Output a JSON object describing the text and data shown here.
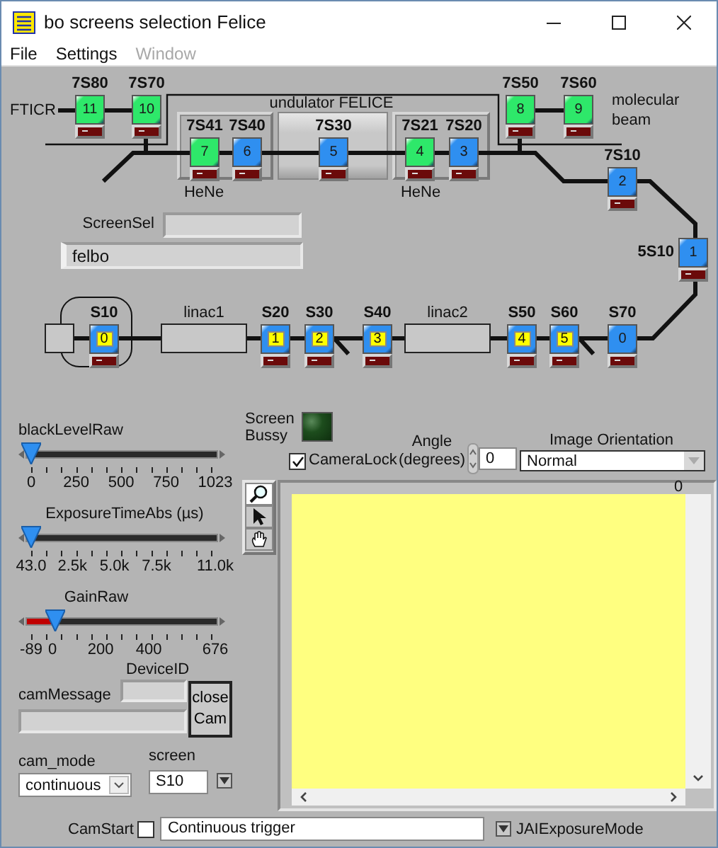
{
  "window": {
    "title": "bo screens selection Felice"
  },
  "menu": [
    {
      "label": "File",
      "disabled": false
    },
    {
      "label": "Settings",
      "disabled": false
    },
    {
      "label": "Window",
      "disabled": true
    }
  ],
  "diagram": {
    "labels": [
      "FTICR",
      "undulator FELICE",
      "molecular beam",
      "HeNe",
      "HeNe",
      "linac1",
      "linac2"
    ],
    "upper_screens": [
      {
        "label": "7S80",
        "number": "11",
        "color": "#2ee86a",
        "active": false
      },
      {
        "label": "7S70",
        "number": "10",
        "color": "#2ee86a",
        "active": false
      },
      {
        "label": "7S41",
        "number": "7",
        "color": "#2ee86a",
        "active": false
      },
      {
        "label": "7S40",
        "number": "6",
        "color": "#2f8ff0",
        "active": false
      },
      {
        "label": "7S30",
        "number": "5",
        "color": "#2f8ff0",
        "active": false
      },
      {
        "label": "7S21",
        "number": "4",
        "color": "#2ee86a",
        "active": false
      },
      {
        "label": "7S20",
        "number": "3",
        "color": "#2f8ff0",
        "active": false
      },
      {
        "label": "7S50",
        "number": "8",
        "color": "#2ee86a",
        "active": false
      },
      {
        "label": "7S60",
        "number": "9",
        "color": "#2ee86a",
        "active": false
      },
      {
        "label": "7S10",
        "number": "2",
        "color": "#2f8ff0",
        "active": false
      },
      {
        "label": "5S10",
        "number": "1",
        "color": "#2f8ff0",
        "active": false
      }
    ],
    "lower_screens": [
      {
        "label": "S10",
        "number": "0",
        "color": "#2f8ff0",
        "active": true
      },
      {
        "label": "S20",
        "number": "1",
        "color": "#2f8ff0",
        "active": true
      },
      {
        "label": "S30",
        "number": "2",
        "color": "#2f8ff0",
        "active": true
      },
      {
        "label": "S40",
        "number": "3",
        "color": "#2f8ff0",
        "active": true
      },
      {
        "label": "S50",
        "number": "4",
        "color": "#2f8ff0",
        "active": true
      },
      {
        "label": "S60",
        "number": "5",
        "color": "#2f8ff0",
        "active": true
      },
      {
        "label": "S70",
        "number": "0",
        "color": "#2f8ff0",
        "active": false
      }
    ]
  },
  "screen_sel": {
    "label": "ScreenSel"
  },
  "server_field": {
    "value": "felbo"
  },
  "sliders": [
    {
      "label": "blackLevelRaw",
      "level": 0,
      "ticks": [
        "0",
        "250",
        "500",
        "750",
        "1023"
      ]
    },
    {
      "label": "ExposureTimeAbs (µs)",
      "level": 0,
      "ticks": [
        "43.0",
        "2.5k",
        "5.0k",
        "7.5k",
        "11.0k"
      ]
    },
    {
      "label": "GainRaw",
      "level": 0.13,
      "ticks": [
        "-89",
        "0",
        "200",
        "400",
        "676"
      ]
    }
  ],
  "screen_busy": {
    "label": "Screen Bussy",
    "on": false
  },
  "camera_lock": {
    "label": "CameraLock",
    "checked": true
  },
  "angle": {
    "label": "Angle (degrees)",
    "value": "0"
  },
  "image_orientation": {
    "label": "Image Orientation",
    "value": "Normal"
  },
  "tools": [
    {
      "kind": "zoom",
      "selected": true
    },
    {
      "kind": "pointer",
      "selected": false
    },
    {
      "kind": "pan",
      "selected": false
    }
  ],
  "image": {
    "scale_label": "0"
  },
  "device_id": {
    "label": "DeviceID"
  },
  "cam_message": {
    "label": "camMessage"
  },
  "close_button": {
    "label": "close Cam"
  },
  "cam_mode": {
    "label": "cam_mode",
    "value": "continuous"
  },
  "screen": {
    "label": "screen",
    "value": "S10"
  },
  "cam_start": {
    "label": "CamStart",
    "checked": false
  },
  "exposure_mode": {
    "label": "JAIExposureMode",
    "value": "Continuous trigger"
  }
}
